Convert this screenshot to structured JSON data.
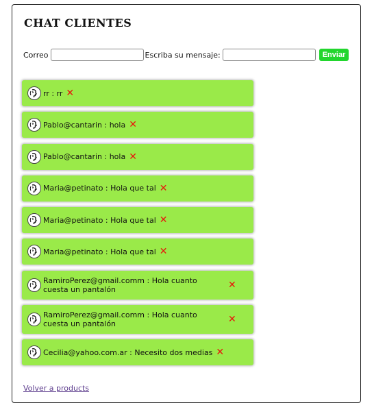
{
  "header": {
    "title": "CHAT CLIENTES"
  },
  "form": {
    "email_label": "Correo",
    "email_value": "",
    "message_label": "Escriba su mensaje:",
    "message_value": "",
    "send_label": "Enviar"
  },
  "messages": [
    {
      "text": "rr : rr"
    },
    {
      "text": "Pablo@cantarin : hola"
    },
    {
      "text": "Pablo@cantarin : hola"
    },
    {
      "text": "Maria@petinato : Hola que tal"
    },
    {
      "text": "Maria@petinato : Hola que tal"
    },
    {
      "text": "Maria@petinato : Hola que tal"
    },
    {
      "text": "RamiroPerez@gmail.comm : Hola cuanto cuesta un pantalón"
    },
    {
      "text": "RamiroPerez@gmail.comm : Hola cuanto cuesta un pantalón"
    },
    {
      "text": "Cecilia@yahoo.com.ar : Necesito dos medias"
    }
  ],
  "icons": {
    "avatar": "speaking-head-icon",
    "delete": "close-x-icon"
  },
  "colors": {
    "message_bg": "#9aea49",
    "send_button": "#22d62e",
    "delete_icon": "#e8150c",
    "link": "#5b3a8c"
  },
  "footer": {
    "back_link": "Volver a products"
  }
}
